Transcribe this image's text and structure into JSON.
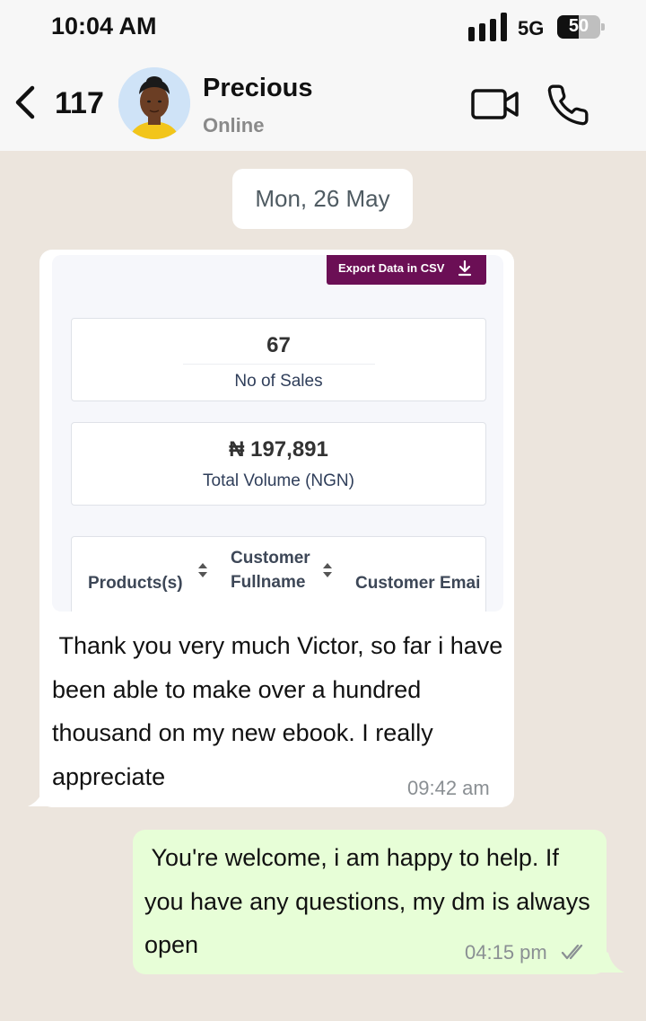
{
  "status_bar": {
    "time": "10:04 AM",
    "network": "5G",
    "battery": "50",
    "battery_level": 0.5,
    "icons": [
      "signal-bars-icon",
      "battery-icon"
    ]
  },
  "header": {
    "unread_count": "117",
    "contact_name": "Precious",
    "contact_status": "Online",
    "icons": [
      "back-arrow-icon",
      "video-call-icon",
      "phone-call-icon"
    ]
  },
  "chat": {
    "date_separator": "Mon, 26 May",
    "incoming": {
      "screenshot": {
        "export_button": "Export Data in CSV",
        "sales_count": "67",
        "sales_label": "No of Sales",
        "volume_value": "₦ 197,891",
        "volume_label": "Total Volume (NGN)",
        "columns": [
          "Products(s)",
          "Customer\nFullname",
          "Customer Emai"
        ]
      },
      "text": " Thank you very much Victor, so far i have been able to make over a hundred thousand on my new ebook. I really appreciate",
      "time": "09:42 am"
    },
    "outgoing": {
      "text": " You're welcome, i am happy to help. If you have any questions, my dm is always open",
      "time": "04:15 pm",
      "read_status_icon": "double-check-icon"
    }
  },
  "colors": {
    "chat_background": "#ece5dd",
    "incoming_bubble": "#ffffff",
    "outgoing_bubble": "#e7fed7",
    "export_button": "#6b0f55",
    "read_ticks": "#8a8f93"
  }
}
